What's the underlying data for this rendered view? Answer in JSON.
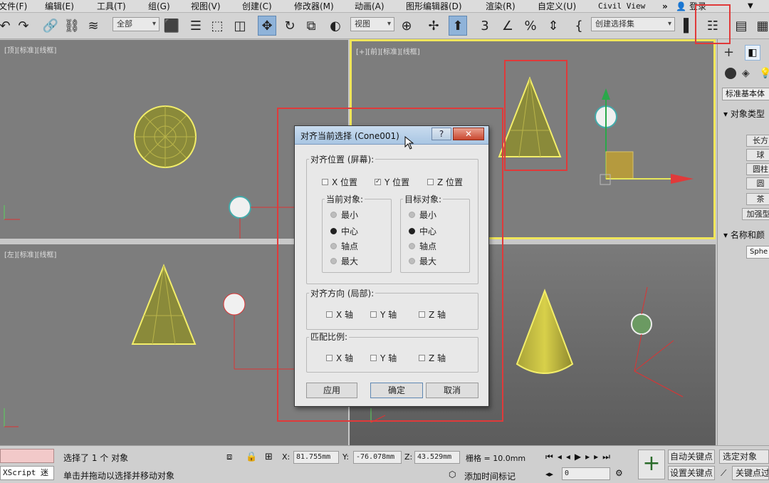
{
  "menubar": {
    "items": [
      "文件(F)",
      "编辑(E)",
      "工具(T)",
      "组(G)",
      "视图(V)",
      "创建(C)",
      "修改器(M)",
      "动画(A)",
      "图形编辑器(D)",
      "渲染(R)",
      "自定义(U)",
      "Civil View"
    ],
    "more": "»",
    "login": "登录"
  },
  "toolbar": {
    "filter_dropdown": "全部",
    "refcoord_dropdown": "视图",
    "selection_set_dropdown": "创建选择集"
  },
  "viewports": {
    "top_left_label": "[顶][标准][线框]",
    "top_right_label": "[+][前][标准][线框]",
    "bottom_left_label": "[左][标准][线框]"
  },
  "command_panel": {
    "category_dropdown": "标准基本体",
    "rollout_object_type": "对象类型",
    "object_buttons": [
      "长方",
      "球",
      "圆柱",
      "圆",
      "茶",
      "加强型"
    ],
    "rollout_name_color": "名称和颜",
    "name_field": "Sphe"
  },
  "dialog": {
    "title": "对齐当前选择 (Cone001)",
    "help_button": "?",
    "close_button": "✕",
    "align_position_label": "对齐位置 (屏幕):",
    "x_position": "X 位置",
    "y_position": "Y 位置",
    "z_position": "Z 位置",
    "current_object_label": "当前对象:",
    "target_object_label": "目标对象:",
    "current_options": [
      "最小",
      "中心",
      "轴点",
      "最大"
    ],
    "current_selected": "中心",
    "target_options": [
      "最小",
      "中心",
      "轴点",
      "最大"
    ],
    "target_selected": "中心",
    "align_orientation_label": "对齐方向 (局部):",
    "match_scale_label": "匹配比例:",
    "x_axis": "X 轴",
    "y_axis": "Y 轴",
    "z_axis": "Z 轴",
    "apply_button": "应用",
    "ok_button": "确定",
    "cancel_button": "取消",
    "checked": {
      "x_position": false,
      "y_position": true,
      "z_position": false
    }
  },
  "statusbar": {
    "maxscript": "XScript 迷",
    "selection_status": "选择了 1 个 对象",
    "prompt": "单击并拖动以选择并移动对象",
    "x_label": "X:",
    "x_value": "81.755mm",
    "y_label": "Y:",
    "y_value": "-76.078mm",
    "z_label": "Z:",
    "z_value": "43.529mm",
    "grid": "栅格 = 10.0mm",
    "add_time_tag": "添加时间标记",
    "frame_value": "0",
    "auto_key": "自动关键点",
    "set_key": "设置关键点",
    "selected_object": "选定对象",
    "key_filters": "关键点过"
  },
  "colors": {
    "viewport_bg": "#7d7d7d",
    "selection_yellow": "#f0e65a",
    "annotation_red": "#e03a3a",
    "active_tool": "#8fb3d9"
  }
}
